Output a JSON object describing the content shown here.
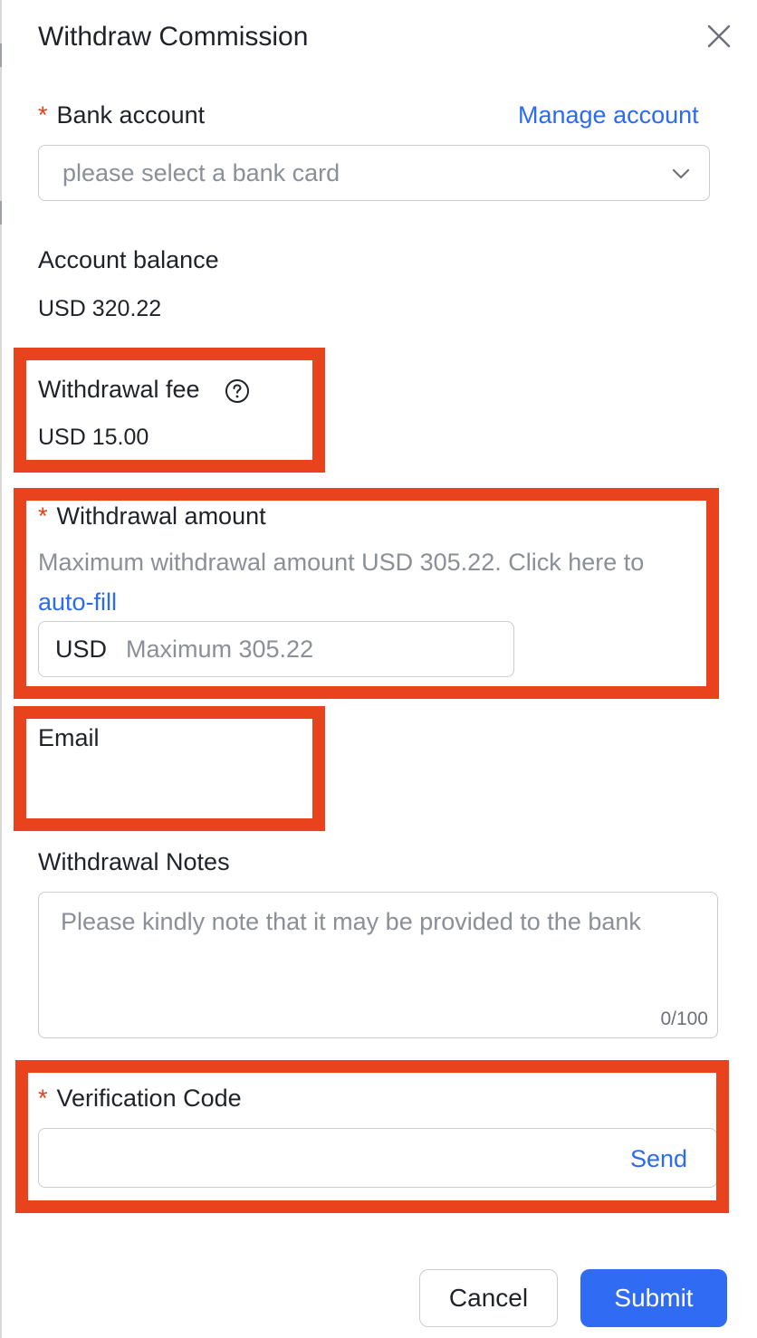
{
  "dialog": {
    "title": "Withdraw Commission"
  },
  "bank_account": {
    "required_mark": "*",
    "label": "Bank account",
    "manage_link": "Manage account",
    "placeholder": "please select a bank card"
  },
  "account_balance": {
    "label": "Account balance",
    "value": "USD 320.22"
  },
  "withdrawal_fee": {
    "label": "Withdrawal fee",
    "value": "USD 15.00"
  },
  "withdrawal_amount": {
    "required_mark": "*",
    "label": "Withdrawal amount",
    "hint": "Maximum withdrawal amount USD 305.22. Click here to",
    "autofill_link": "auto-fill",
    "currency_prefix": "USD",
    "placeholder": "Maximum 305.22"
  },
  "email": {
    "label": "Email"
  },
  "notes": {
    "label": "Withdrawal Notes",
    "placeholder": "Please kindly note that it may be provided to the bank",
    "counter": "0/100"
  },
  "verification": {
    "required_mark": "*",
    "label": "Verification Code",
    "send_label": "Send"
  },
  "footer": {
    "cancel_label": "Cancel",
    "submit_label": "Submit"
  },
  "colors": {
    "accent": "#2f6cf3",
    "link": "#2b6bf2",
    "required": "#e0411b",
    "highlight": "#e8431d"
  }
}
